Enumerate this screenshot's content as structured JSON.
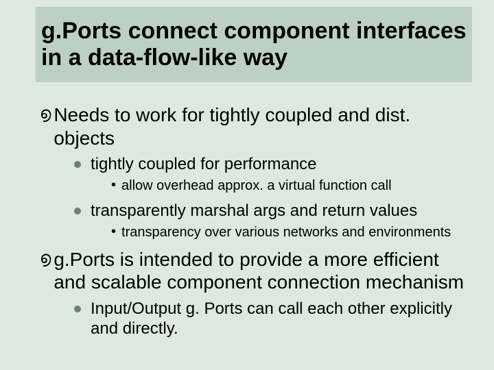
{
  "title": "g.Ports connect component interfaces in a data-flow-like way",
  "items": [
    {
      "level": 1,
      "text": "Needs to work for tightly coupled and dist. objects"
    },
    {
      "level": 2,
      "text": "tightly coupled for performance"
    },
    {
      "level": 3,
      "text": "allow overhead approx. a virtual function call"
    },
    {
      "level": 2,
      "text": "transparently marshal args and return values"
    },
    {
      "level": 3,
      "text": "transparency over various networks and environments"
    },
    {
      "level": 1,
      "text": "g.Ports is intended to provide a more efficient and scalable component connection mechanism"
    },
    {
      "level": 2,
      "text": "Input/Output g. Ports can call each other explicitly and directly."
    }
  ],
  "bullets": {
    "lvl1": "൭",
    "lvl3": "•"
  }
}
